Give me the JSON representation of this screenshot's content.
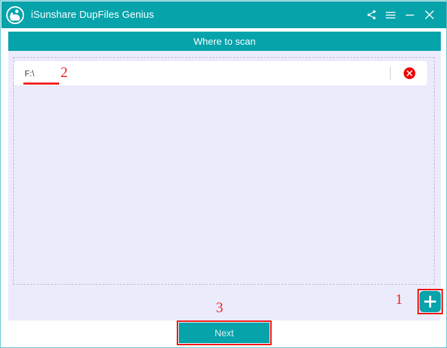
{
  "window": {
    "title": "iSunshare DupFiles Genius",
    "logo_icon": "isunshare-logo-icon",
    "accent_color": "#06a3ab",
    "panel_color": "#ebebfb",
    "annotation_color": "#ee2222"
  },
  "titlebar_actions": [
    {
      "name": "share-icon",
      "label": "Share"
    },
    {
      "name": "menu-icon",
      "label": "Menu"
    },
    {
      "name": "minimize-icon",
      "label": "Minimize"
    },
    {
      "name": "close-icon",
      "label": "Close"
    }
  ],
  "section": {
    "header_label": "Where to scan"
  },
  "paths": [
    {
      "value": "F:\\",
      "delete_icon": "delete-circle-x-icon"
    }
  ],
  "buttons": {
    "add_label": "+",
    "add_icon": "plus-icon",
    "next_label": "Next"
  },
  "annotations": {
    "step1": "1",
    "step2": "2",
    "step3": "3"
  }
}
